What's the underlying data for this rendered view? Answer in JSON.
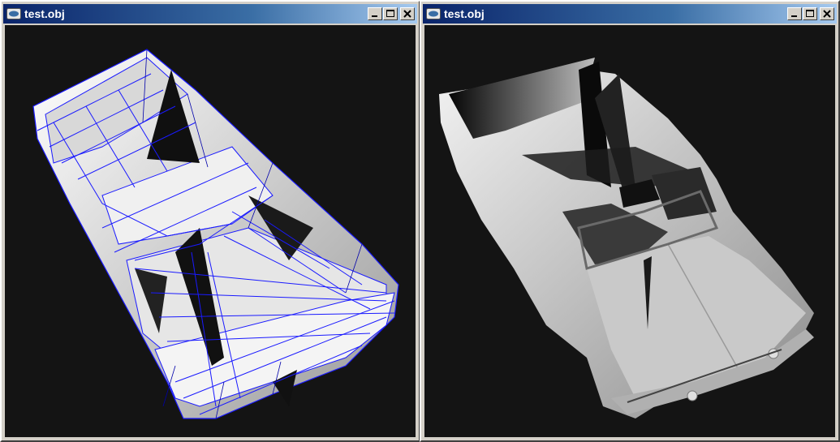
{
  "windows": [
    {
      "title": "test.obj",
      "render_mode": "shaded with wireframe overlay",
      "wire_color": "#1a1aff"
    },
    {
      "title": "test.obj",
      "render_mode": "shaded"
    }
  ],
  "title_buttons": [
    "minimize-icon",
    "maximize-icon",
    "close-icon"
  ],
  "colors": {
    "titlebar_start": "#0a246a",
    "titlebar_end": "#a6caf0",
    "viewport_bg": "#141414",
    "chrome": "#d4d0c8"
  }
}
